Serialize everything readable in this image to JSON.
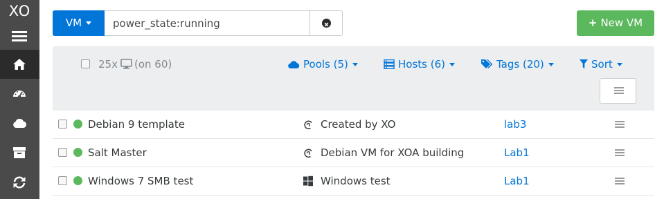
{
  "app": {
    "logo": "XO"
  },
  "sidebar": {
    "items": [
      {
        "icon": "home-icon",
        "active": true
      },
      {
        "icon": "dashboard-icon",
        "active": false
      },
      {
        "icon": "cloud-icon",
        "active": false
      },
      {
        "icon": "archive-icon",
        "active": false
      },
      {
        "icon": "refresh-icon",
        "active": false
      }
    ]
  },
  "toolbar": {
    "type_label": "VM",
    "filter_value": "power_state:running",
    "new_vm_label": "New VM"
  },
  "list_header": {
    "count_label": "25x",
    "count_total": "(on 60)",
    "pools_label": "Pools (5)",
    "hosts_label": "Hosts (6)",
    "tags_label": "Tags (20)",
    "sort_label": "Sort"
  },
  "vms": [
    {
      "name": "Debian 9 template",
      "os_icon": "debian-icon",
      "description": "Created by XO",
      "host": "lab3",
      "status": "running"
    },
    {
      "name": "Salt Master",
      "os_icon": "debian-icon",
      "description": "Debian VM for XOA building",
      "host": "Lab1",
      "status": "running"
    },
    {
      "name": "Windows 7 SMB test",
      "os_icon": "windows-icon",
      "description": "Windows test",
      "host": "Lab1",
      "status": "running"
    }
  ],
  "colors": {
    "primary": "#0275d8",
    "success": "#5cb85c",
    "sidebar": "#4a4a4a",
    "sidebar_active": "#2b2b2b",
    "header_bg": "#eceeef"
  }
}
